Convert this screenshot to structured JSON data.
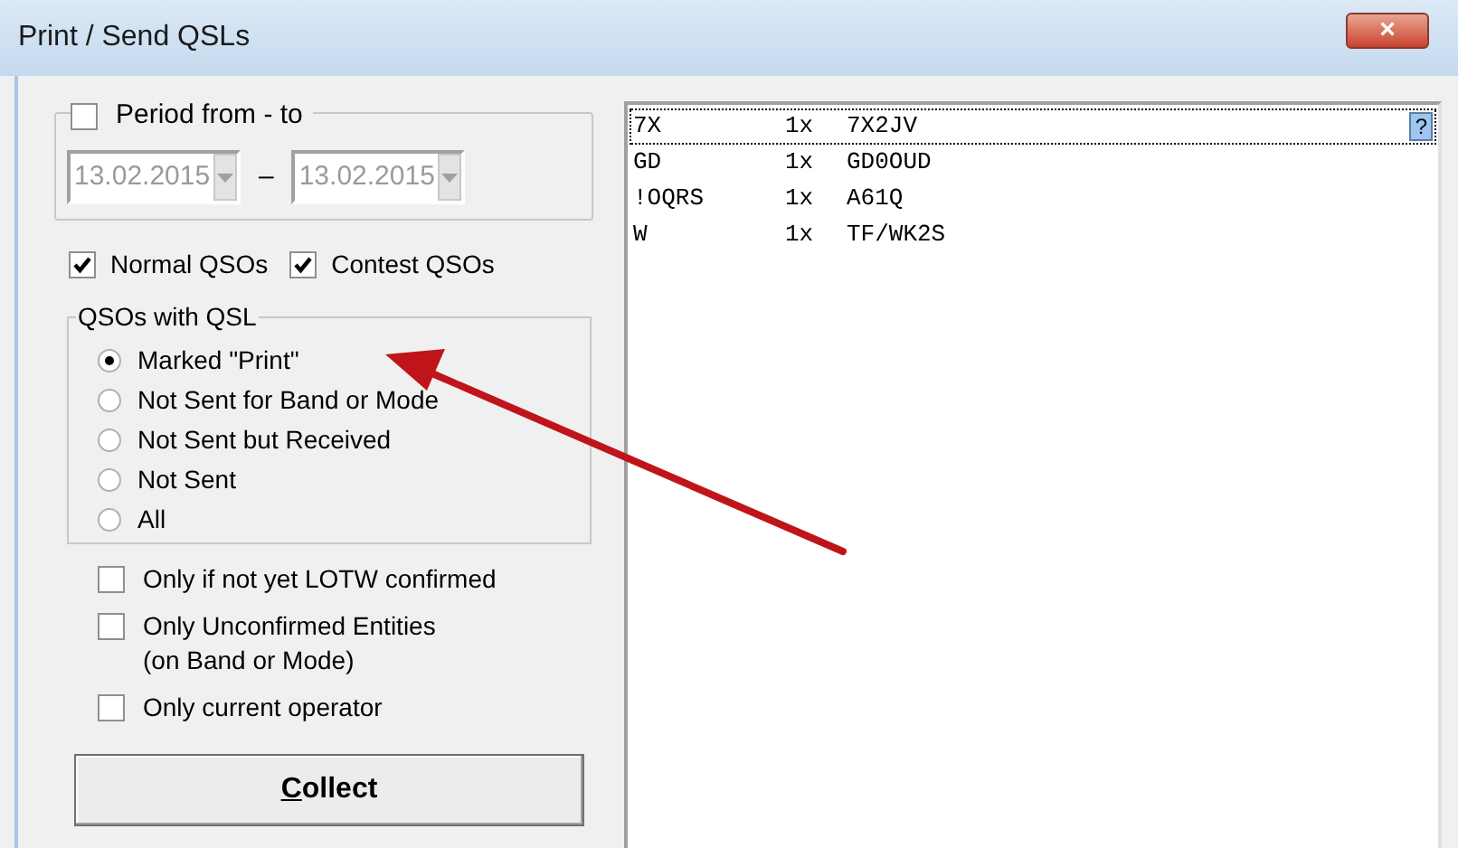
{
  "window": {
    "title": "Print / Send QSLs",
    "close": "×"
  },
  "period": {
    "label": "Period from - to",
    "checked": false,
    "from": "13.02.2015",
    "separator": "–",
    "to": "13.02.2015",
    "disabled": true
  },
  "qso_types": [
    {
      "label": "Normal QSOs",
      "checked": true
    },
    {
      "label": "Contest QSOs",
      "checked": true
    }
  ],
  "qsl_group": {
    "title": "QSOs with QSL",
    "options": [
      {
        "label": "Marked \"Print\"",
        "selected": true
      },
      {
        "label": "Not Sent for Band or Mode",
        "selected": false
      },
      {
        "label": "Not Sent but Received",
        "selected": false
      },
      {
        "label": "Not Sent",
        "selected": false
      },
      {
        "label": "All",
        "selected": false
      }
    ]
  },
  "filters": [
    {
      "label": "Only if not yet LOTW confirmed",
      "checked": false
    },
    {
      "label": "Only Unconfirmed Entities\n(on Band or Mode)",
      "checked": false
    },
    {
      "label": "Only current operator",
      "checked": false
    }
  ],
  "collect_button": {
    "parts": [
      {
        "text": "C",
        "underlined": true
      },
      {
        "text": "ollect",
        "underlined": false
      }
    ]
  },
  "list": {
    "rows": [
      {
        "prefix": "7X",
        "count": "1x",
        "call": "7X2JV",
        "selected": true,
        "badge": "?"
      },
      {
        "prefix": "GD",
        "count": "1x",
        "call": "GD0OUD",
        "selected": false
      },
      {
        "prefix": "!OQRS",
        "count": "1x",
        "call": "A61Q",
        "selected": false
      },
      {
        "prefix": "W",
        "count": "1x",
        "call": "TF/WK2S",
        "selected": false
      }
    ]
  },
  "annotation": {
    "kind": "arrow",
    "color": "#c0141b"
  }
}
